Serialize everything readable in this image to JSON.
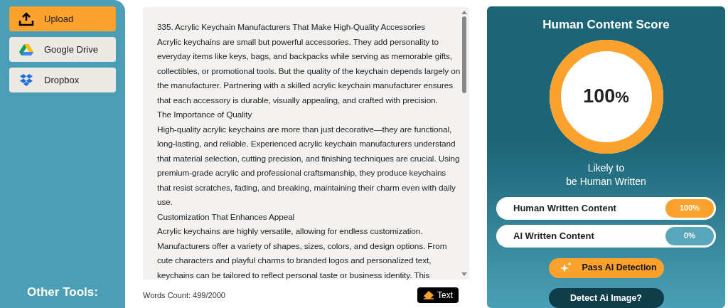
{
  "sidebar": {
    "items": [
      {
        "label": "Upload",
        "selected": true,
        "kind": "upload"
      },
      {
        "label": "Google Drive",
        "selected": false,
        "kind": "drive"
      },
      {
        "label": "Dropbox",
        "selected": false,
        "kind": "dropbox"
      }
    ],
    "footer": "Other Tools:"
  },
  "editor": {
    "lines": [
      "335. Acrylic Keychain Manufacturers That Make High-Quality Accessories",
      "Acrylic keychains are small but powerful accessories. They add personality to",
      "everyday items like keys, bags, and backpacks while serving as memorable gifts,",
      "collectibles, or promotional tools. But the quality of the keychain depends largely on",
      "the manufacturer. Partnering with a skilled acrylic keychain manufacturer ensures",
      "that each accessory is durable, visually appealing, and crafted with precision.",
      "The Importance of Quality",
      "High-quality acrylic keychains are more than just decorative—they are functional,",
      "long-lasting, and reliable. Experienced acrylic keychain manufacturers understand",
      "that material selection, cutting precision, and finishing techniques are crucial. Using",
      "premium-grade acrylic and professional craftsmanship, they produce keychains",
      "that resist scratches, fading, and breaking, maintaining their charm even with daily",
      "use.",
      "Customization That Enhances Appeal",
      "Acrylic keychains are highly versatile, allowing for endless customization.",
      "Manufacturers offer a variety of shapes, sizes, colors, and design options. From",
      "cute characters and playful charms to branded logos and personalized text,",
      "keychains can be tailored to reflect personal taste or business identity. This"
    ],
    "word_count": "Words Count: 499/2000",
    "clear_button": "Text"
  },
  "score": {
    "title": "Human Content Score",
    "value": "100",
    "unit": "%",
    "level": 1,
    "verdict_lines": [
      "Likely to",
      "be Human Written"
    ],
    "rows": [
      {
        "label": "Human Written Content",
        "value": "100%",
        "color": "#fca22c"
      },
      {
        "label": "AI Written Content",
        "value": "0%",
        "color": "#57a6bb"
      }
    ],
    "pass_button": "Pass AI Detection",
    "detect_button": "Detect Ai Image?"
  }
}
